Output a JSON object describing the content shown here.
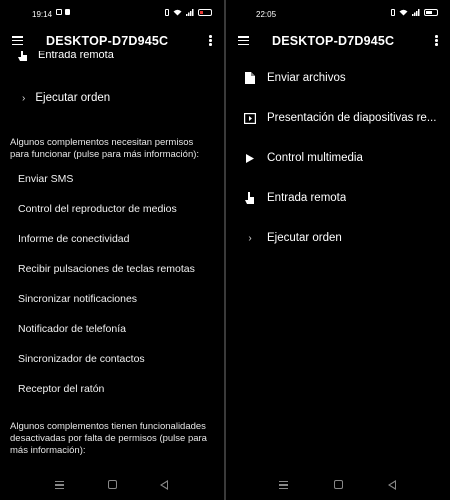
{
  "left_screen": {
    "status": {
      "time": "19:14",
      "battery": "20"
    },
    "title": "DESKTOP-D7D945C",
    "actions": [
      {
        "label": "Entrada remota"
      },
      {
        "label": "Ejecutar orden"
      }
    ],
    "permissions_note": "Algunos complementos necesitan permisos para funcionar (pulse para más información):",
    "plugins_needing_permissions": [
      "Enviar SMS",
      "Control del reproductor de medios",
      "Informe de conectividad",
      "Recibir pulsaciones de teclas remotas",
      "Sincronizar notificaciones",
      "Notificador de telefonía",
      "Sincronizador de contactos",
      "Receptor del ratón"
    ],
    "disabled_note": "Algunos complementos tienen funcionalidades desactivadas por falta de permisos (pulse para más información):"
  },
  "right_screen": {
    "status": {
      "time": "22:05",
      "battery": "42"
    },
    "title": "DESKTOP-D7D945C",
    "actions": [
      {
        "label": "Enviar archivos",
        "icon": "file-icon"
      },
      {
        "label": "Presentación de diapositivas re...",
        "icon": "presentation-icon"
      },
      {
        "label": "Control multimedia",
        "icon": "play-icon"
      },
      {
        "label": "Entrada remota",
        "icon": "touch-icon"
      },
      {
        "label": "Ejecutar orden",
        "icon": "chevron-right-icon"
      }
    ]
  }
}
